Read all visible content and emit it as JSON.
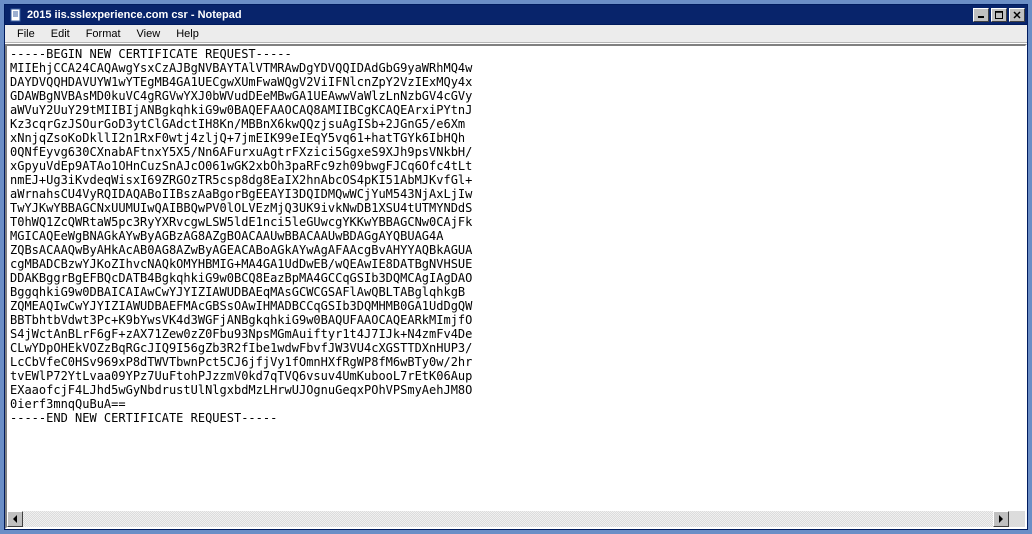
{
  "window": {
    "title": "2015 iis.sslexperience.com csr - Notepad"
  },
  "menu": {
    "file": "File",
    "edit": "Edit",
    "format": "Format",
    "view": "View",
    "help": "Help"
  },
  "content": "-----BEGIN NEW CERTIFICATE REQUEST-----\nMIIEhjCCA24CAQAwgYsxCzAJBgNVBAYTAlVTMRAwDgYDVQQIDAdGbG9yaWRhMQ4w\nDAYDVQQHDAVUYW1wYTEgMB4GA1UECgwXUmFwaWQgV2ViIFNlcnZpY2VzIExMQy4x\nGDAWBgNVBAsMD0kuVC4gRGVwYXJ0bWVudDEeMBwGA1UEAwwVaWlzLnNzbGV4cGVy\naWVuY2UuY29tMIIBIjANBgkqhkiG9w0BAQEFAAOCAQ8AMIIBCgKCAQEArxiPYtnJ\nKz3cqrGzJSOurGoD3ytClGAdctIH8Kn/MBBnX6kwQQzjsuAgISb+2JGnG5/e6Xm\nxNnjqZsoKoDkllI2n1RxF0wtj4zljQ+7jmEIK99eIEqY5vq61+hatTGYk6IbHQh\n0QNfEyvg630CXnabAFtnxY5X5/Nn6AFurxuAgtrFXzici5GgxeS9XJh9psVNkbH/\nxGpyuVdEp9ATAo1OHnCuzSnAJcO061wGK2xbOh3paRFc9zh09bwgFJCq6Ofc4tLt\nnmEJ+Ug3iKvdeqWisxI69ZRGOzTR5csp8dg8EaIX2hnAbcOS4pKI51AbMJKvfGl+\naWrnahsCU4VyRQIDAQABoIIBszAaBgorBgEEAYI3DQIDMQwWCjYuM543NjAxLjIw\nTwYJKwYBBAGCNxUUMUIwQAIBBQwPV0lOLVEzMjQ3UK9ivkNwDB1XSU4tUTMYNDdS\nT0hWQ1ZcQWRtaW5pc3RyYXRvcgwLSW5ldE1nci5leGUwcgYKKwYBBAGCNw0CAjFk\nMGICAQEeWgBNAGkAYwByAGBzAG8AZgBOACAAUwBBACAAUwBDAGgAYQBUAG4A\nZQBsACAAQwByAHkAcAB0AG8AZwByAGEACABoAGkAYwAgAFAAcgBvAHYYAQBkAGUA\ncgMBADCBzwYJKoZIhvcNAQkOMYHBMIG+MA4GA1UdDwEB/wQEAwIE8DATBgNVHSUE\nDDAKBggrBgEFBQcDATB4BgkqhkiG9w0BCQ8EazBpMA4GCCqGSIb3DQMCAgIAgDAO\nBggqhkiG9w0DBAICAIAwCwYJYIZIAWUDBAEqMAsGCWCGSAFlAwQBLTABglqhkgB\nZQMEAQIwCwYJYIZIAWUDBAEFMAcGBSsOAwIHMADBCCqGSIb3DQMHMB0GA1UdDgQW\nBBTbhtbVdwt3Pc+K9bYwsVK4d3WGFjANBgkqhkiG9w0BAQUFAAOCAQEARkMImjfO\nS4jWctAnBLrF6gF+zAX71Zew0zZ0Fbu93NpsMGmAuiftyr1t4J7IJk+N4zmFv4De\nCLwYDpOHEkVOZzBqRGcJIQ9I56gZb3R2fIbe1wdwFbvfJW3VU4cXGSTTDXnHUP3/\nLcCbVfeC0HSv969xP8dTWVTbwnPct5CJ6jfjVy1fOmnHXfRgWP8fM6wBTy0w/2hr\ntvEWlP72YtLvaa09YPz7UuFtohPJzzmV0kd7qTVQ6vsuv4UmKubooL7rEtK06Aup\nEXaaofcjF4LJhd5wGyNbdrustUlNlgxbdMzLHrwUJOgnuGeqxPOhVPSmyAehJM8O\n0ierf3mnqQuBuA==\n-----END NEW CERTIFICATE REQUEST-----"
}
